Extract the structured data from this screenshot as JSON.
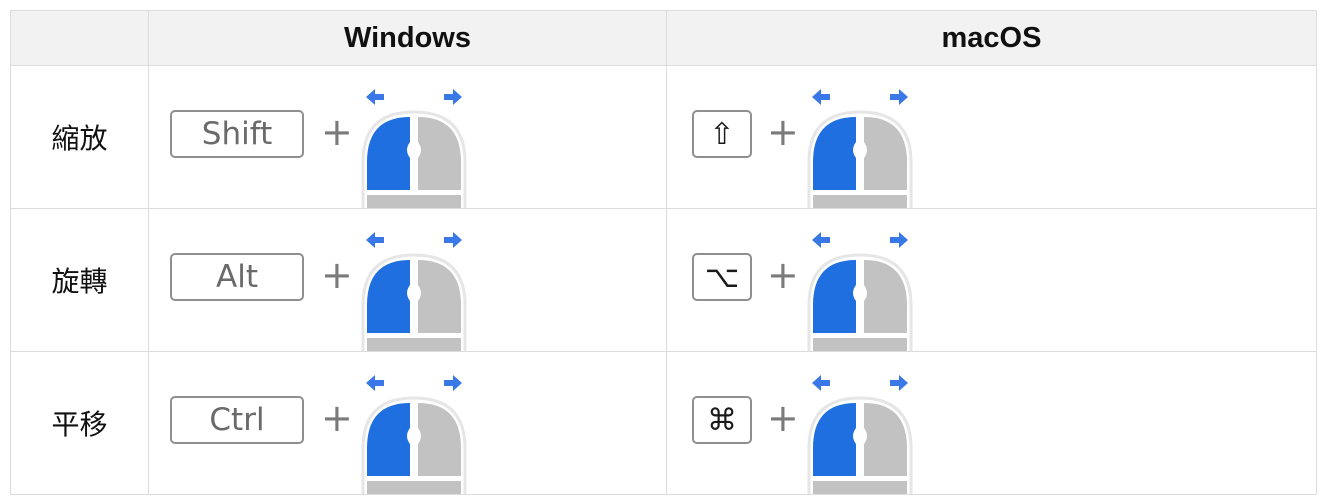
{
  "header": {
    "corner": "",
    "windows": "Windows",
    "macos": "macOS"
  },
  "rows": [
    {
      "action": "縮放",
      "windows_key": "Shift",
      "mac_key": "⇧",
      "mac_key_icon": "shift-icon",
      "plus": "+"
    },
    {
      "action": "旋轉",
      "windows_key": "Alt",
      "mac_key": "⌥",
      "mac_key_icon": "option-icon",
      "plus": "+"
    },
    {
      "action": "平移",
      "windows_key": "Ctrl",
      "mac_key": "⌘",
      "mac_key_icon": "command-icon",
      "plus": "+"
    }
  ],
  "colors": {
    "button_active": "#1f6fe0",
    "button_inactive": "#c2c2c2",
    "arrow": "#3b78e7",
    "border": "#dcdcdc",
    "header_bg": "#f2f2f2"
  }
}
